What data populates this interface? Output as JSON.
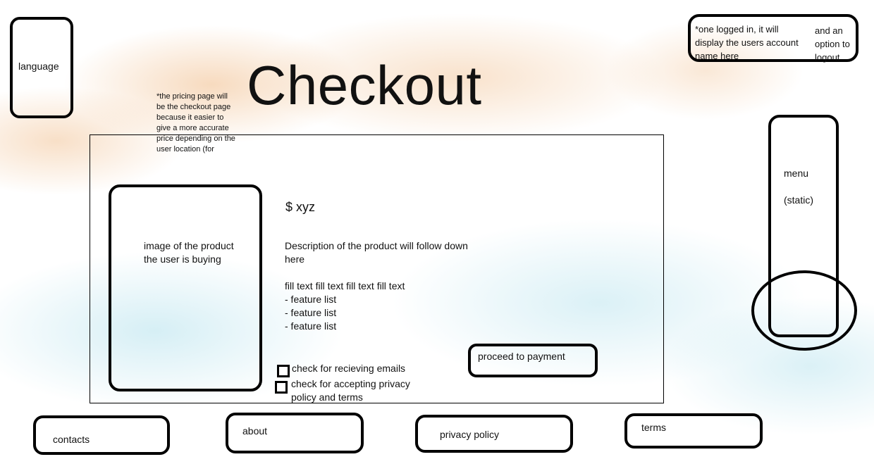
{
  "header": {
    "language_label": "language",
    "title": "Checkout",
    "account_note": "*one logged in, it will display the users account name here",
    "logout_note": "and an option to logout"
  },
  "pricing_note": "*the pricing page will be the checkout page because it easier to give a more accurate price depending on the user location (for",
  "product": {
    "image_placeholder": "image of the product the user is buying",
    "price": "$ xyz",
    "description": "Description of the product will follow down here\n\nfill text fill text fill text fill text\n- feature list\n- feature list\n- feature list"
  },
  "checkboxes": {
    "emails_label": "check for recieving emails",
    "terms_label": "check for accepting privacy policy and terms"
  },
  "payment_button_label": "proceed to payment",
  "menu": {
    "label": "menu",
    "note": "(static)"
  },
  "footer": {
    "contacts": "contacts",
    "about": "about",
    "privacy": "privacy policy",
    "terms": "terms"
  },
  "colors": {
    "orange_texture": "#E8964A",
    "blue_texture": "#5ABED7",
    "outline": "#000000"
  }
}
